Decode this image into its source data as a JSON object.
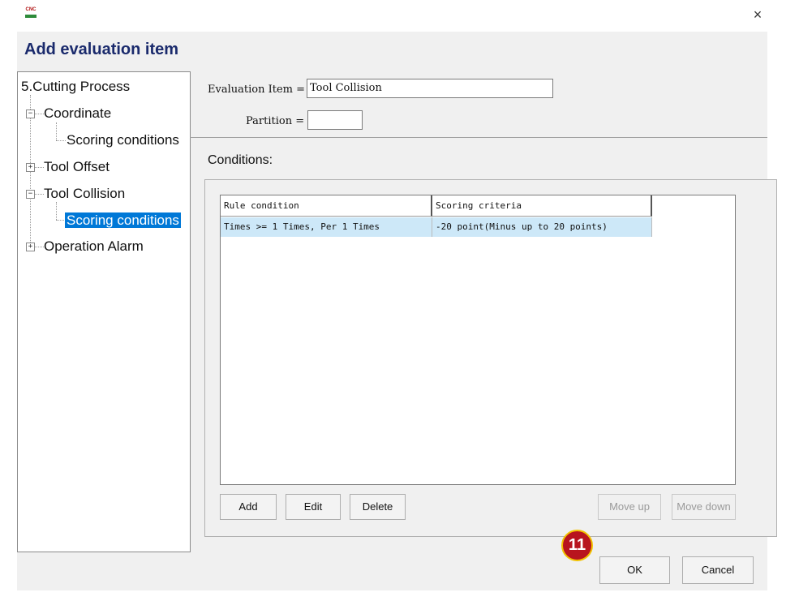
{
  "window": {
    "app_icon_text": "CNC",
    "close_glyph": "×"
  },
  "dialog": {
    "title": "Add evaluation item"
  },
  "tree": {
    "root": "5.Cutting Process",
    "items": [
      {
        "label": "Coordinate",
        "expander": "−"
      },
      {
        "label": "Scoring conditions"
      },
      {
        "label": "Tool Offset",
        "expander": "+"
      },
      {
        "label": "Tool Collision",
        "expander": "−"
      },
      {
        "label": "Scoring conditions",
        "selected": true
      },
      {
        "label": "Operation Alarm",
        "expander": "+"
      }
    ]
  },
  "form": {
    "evaluation_item_label": "Evaluation Item =",
    "evaluation_item_value": "Tool Collision",
    "partition_label": "Partition =",
    "partition_value": ""
  },
  "conditions": {
    "label": "Conditions:",
    "columns": [
      "Rule condition",
      "Scoring criteria"
    ],
    "rows": [
      {
        "rule": "Times >= 1 Times, Per 1 Times",
        "score": "-20 point(Minus up to 20 points)"
      }
    ]
  },
  "buttons": {
    "add": "Add",
    "edit": "Edit",
    "delete": "Delete",
    "move_up": "Move up",
    "move_down": "Move down",
    "ok": "OK",
    "cancel": "Cancel"
  },
  "callout": {
    "number": "11"
  },
  "colors": {
    "title": "#1a2a6c",
    "selection": "#0078d7",
    "row_highlight": "#cde8f8",
    "badge": "#b8141e",
    "badge_ring": "#f2c200"
  }
}
